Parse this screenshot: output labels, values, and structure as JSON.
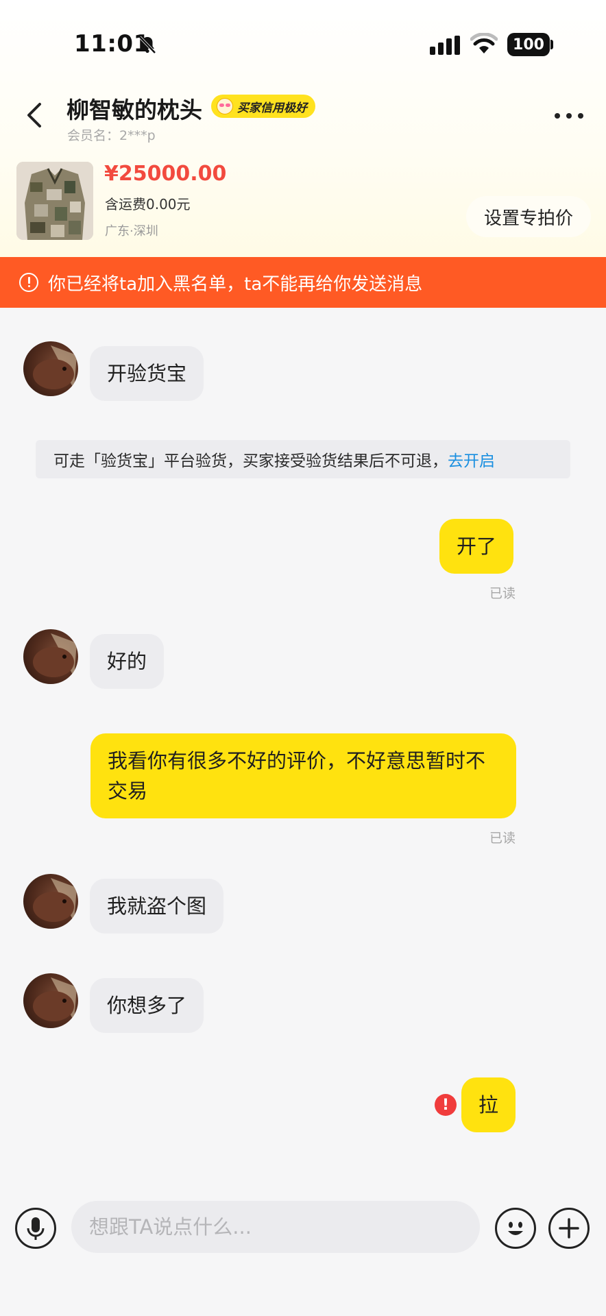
{
  "status_bar": {
    "time": "11:01",
    "battery": "100"
  },
  "header": {
    "title": "柳智敏的枕头",
    "badge": "买家信用极好",
    "member_name": "会员名：2***p"
  },
  "product": {
    "price": "¥25000.00",
    "shipping": "含运费0.00元",
    "location": "广东·深圳",
    "special_price_button": "设置专拍价"
  },
  "banner": {
    "text": "你已经将ta加入黑名单，ta不能再给你发送消息"
  },
  "messages": {
    "m1": "开验货宝",
    "notice_text": "可走「验货宝」平台验货，买家接受验货结果后不可退，",
    "notice_link": "去开启",
    "m2": "开了",
    "m2_status": "已读",
    "m3": "好的",
    "m4": "我看你有很多不好的评价，不好意思暂时不交易",
    "m4_status": "已读",
    "m5": "我就盗个图",
    "m6": "你想多了",
    "m7": "拉"
  },
  "input": {
    "placeholder": "想跟TA说点什么..."
  },
  "colors": {
    "accent": "#ffe20f",
    "banner": "#ff5a24",
    "price": "#f24a3e",
    "link": "#1a8fe0"
  }
}
